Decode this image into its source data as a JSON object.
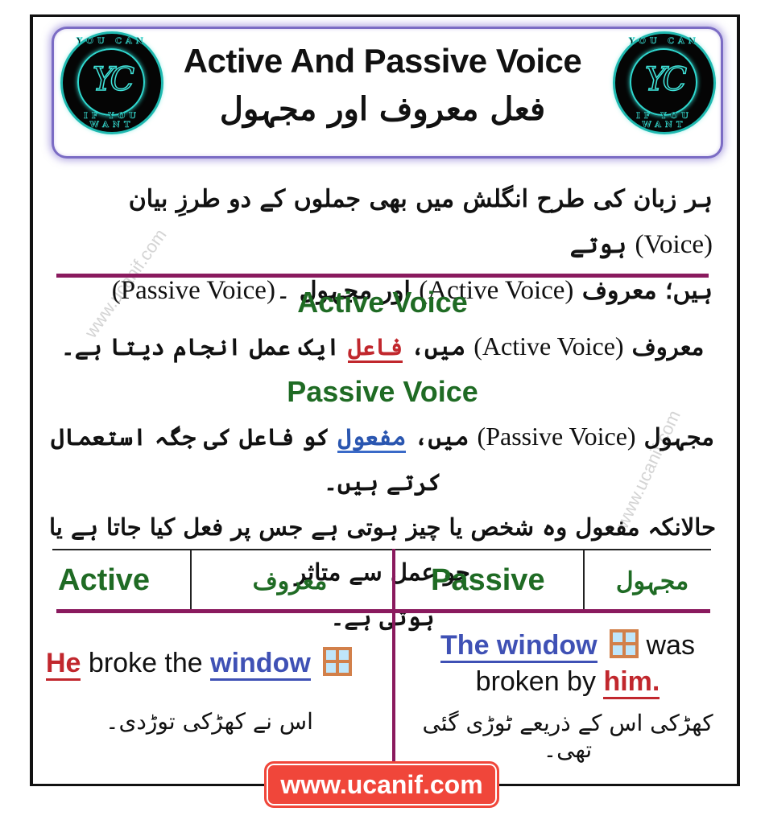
{
  "header": {
    "title": "Active And Passive Voice",
    "subtitle_urdu": "فعل معروف اور مجہول",
    "logo": {
      "monogram": "YC",
      "top_text": "YOU CAN",
      "bottom_text": "IF YOU WANT"
    }
  },
  "intro": {
    "line1_urdu_a": "ہر زبان کی طرح انگلش میں بھی جملوں کے دو طرزِ بیان",
    "line1_eng": "(Voice)",
    "line1_urdu_b": "ہوتے",
    "line2_urdu_a": "ہیں؛ معروف",
    "line2_eng_a": "(Active Voice)",
    "line2_urdu_b": "اور مجہول",
    "line2_eng_b": "(Passive Voice)۔"
  },
  "active_section": {
    "heading": "Active Voice",
    "text_urdu_a": "معروف",
    "text_eng": "(Active Voice)",
    "text_urdu_b": "میں،",
    "highlight": "فاعل",
    "text_urdu_c": "ایک عمل انجام دیتا ہے۔"
  },
  "passive_section": {
    "heading": "Passive Voice",
    "text_urdu_a": "مجہول",
    "text_eng": "(Passive Voice)",
    "text_urdu_b": "میں،",
    "highlight": "مفعول",
    "text_urdu_c": "کو فاعل کی جگہ استعمال کرتے ہیں۔",
    "line2": "حالانکہ مفعول وہ شخص یا چیز ہوتی ہے جس پر فعل کیا جاتا ہے یا جو عمل سے متاثر",
    "line3": "ہوتی ہے۔"
  },
  "table": {
    "headers": [
      {
        "label": "Active"
      },
      {
        "label": "معروف"
      },
      {
        "label": "Passive"
      },
      {
        "label": "مجہول"
      }
    ],
    "active_example": {
      "subject": "He",
      "middle": "broke the",
      "object": "window",
      "icon": "window-icon",
      "urdu": "اس نے کھڑکی توڑدی۔"
    },
    "passive_example": {
      "subject": "The window",
      "icon": "window-icon",
      "middle1": "was",
      "middle2": "broken by",
      "agent": "him.",
      "urdu": "کھڑکی اس کے ذریعے ٹوڑی گئی تھی۔"
    }
  },
  "footer": {
    "url": "www.ucanif.com"
  },
  "watermark": "www.ucanif.com",
  "colors": {
    "heading_green": "#1f6b24",
    "divider_maroon": "#8a1a5e",
    "highlight_red": "#c1272d",
    "highlight_blue": "#3f51b5",
    "badge_red": "#f0463a",
    "header_glow": "#7b6cc4",
    "logo_teal": "#2fd8cf"
  }
}
